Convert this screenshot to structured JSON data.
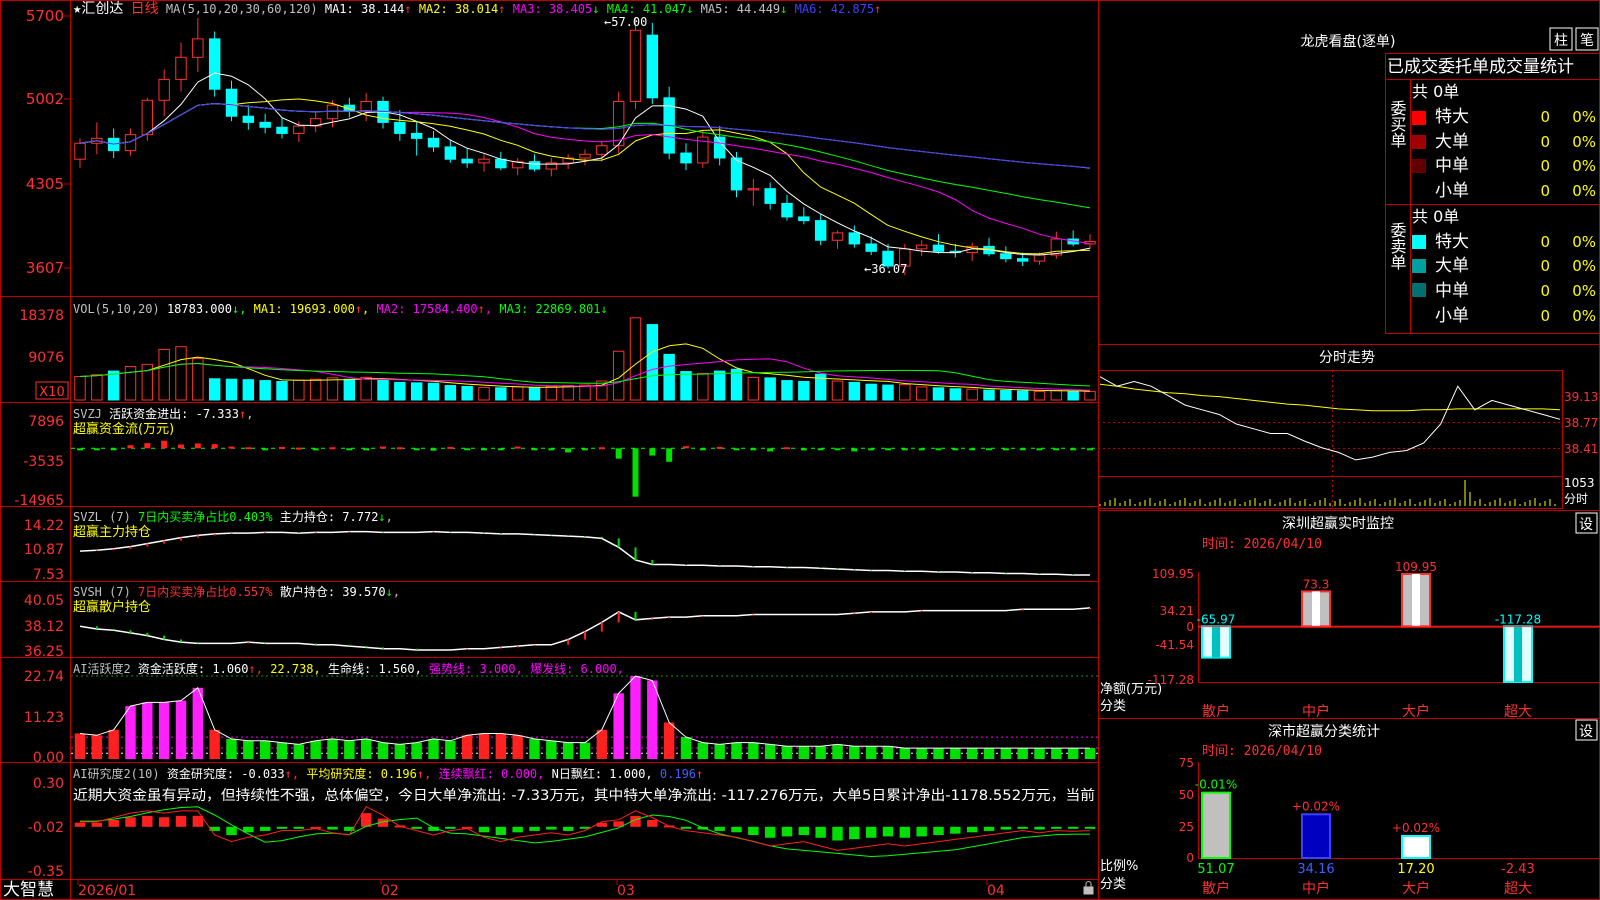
{
  "stock": {
    "name": "★汇创达",
    "period_label": "日线"
  },
  "price_panel": {
    "ma_label": "MA(5,10,20,30,60,120)",
    "mas": [
      {
        "label": "MA1: 38.144",
        "arrow": "↑",
        "color": "#ffffff"
      },
      {
        "label": "MA2: 38.014",
        "arrow": "↑",
        "color": "#ffff00"
      },
      {
        "label": "MA3: 38.405",
        "arrow": "↓",
        "color": "#ff00ff"
      },
      {
        "label": "MA4: 41.047",
        "arrow": "↓",
        "color": "#00ff00"
      },
      {
        "label": "MA5: 44.449",
        "arrow": "↓",
        "color": "#c0c0c0"
      },
      {
        "label": "MA6: 42.875",
        "arrow": "↑",
        "color": "#4040ff"
      }
    ],
    "yticks": [
      "5700",
      "5002",
      "4305",
      "3607"
    ],
    "high_label": "57.00",
    "low_label": "36.07"
  },
  "vol_panel": {
    "label": "VOL(5,10,20)",
    "value": "18783.000",
    "mas": [
      {
        "label": "MA1: 19693.000",
        "arrow": "↑",
        "color": "#ffff00"
      },
      {
        "label": "MA2: 17584.400",
        "arrow": "↑",
        "color": "#ff00ff"
      },
      {
        "label": "MA3: 22869.801",
        "arrow": "↓",
        "color": "#00ff00"
      }
    ],
    "yticks": [
      "18378",
      "9076"
    ],
    "unit": "X10"
  },
  "svzj_panel": {
    "label": "SVZJ",
    "desc": "活跃资金进出: -7.333",
    "arrow": "↑",
    "subtitle": "超赢资金流(万元)",
    "yticks": [
      "7896",
      "-3535",
      "-14965"
    ]
  },
  "svzl_panel": {
    "label": "SVZL (7)",
    "desc": "7日内买卖净占比0.403%",
    "hold": "主力持仓: 7.772",
    "arrow": "↓",
    "subtitle": "超赢主力持仓",
    "yticks": [
      "14.22",
      "10.87",
      "7.53"
    ]
  },
  "svsh_panel": {
    "label": "SVSH (7)",
    "desc": "7日内买卖净占比0.557%",
    "hold": "散户持仓: 39.570",
    "arrow": "↓",
    "subtitle": "超赢散户持仓",
    "yticks": [
      "40.05",
      "38.12",
      "36.25"
    ]
  },
  "ai_active_panel": {
    "label": "AI活跃度2",
    "desc": "资金活跃度: 1.060",
    "v2": "22.738,",
    "life": "生命线: 1.560,",
    "strong": "强势线: 3.000,",
    "burst": "爆发线: 6.000,",
    "yticks": [
      "22.74",
      "11.23",
      "0.00"
    ]
  },
  "ai_research_panel": {
    "label": "AI研究度2(10)",
    "desc": "资金研究度: -0.033",
    "avg": "平均研究度: 0.196",
    "consec": "连续飘红: 0.000,",
    "nday": "N日飘红: 1.000,",
    "last": "0.196",
    "comment": "近期大资金虽有异动，但持续性不强，总体偏空，今日大单净流出: -7.33万元，其中特大单净流出: -117.276万元，大单5日累计净出-1178.552万元，当前",
    "yticks": [
      "0.30",
      "-0.02",
      "-0.35"
    ]
  },
  "xaxis": {
    "labels": [
      "2026/01",
      "02",
      "03",
      "04"
    ]
  },
  "brand": "大智慧",
  "right": {
    "lhb": {
      "title": "龙虎看盘(逐单)",
      "btn1": "柱",
      "btn2": "笔",
      "tabs": "已成交委托单成交量统计"
    },
    "buy": {
      "side": "委买单",
      "total": "共 0单",
      "rows": [
        {
          "name": "特大",
          "count": "0",
          "pct": "0%",
          "color": "#ff0000"
        },
        {
          "name": "大单",
          "count": "0",
          "pct": "0%",
          "color": "#a00000"
        },
        {
          "name": "中单",
          "count": "0",
          "pct": "0%",
          "color": "#600000"
        },
        {
          "name": "小单",
          "count": "0",
          "pct": "0%",
          "color": ""
        }
      ]
    },
    "sell": {
      "side": "委卖单",
      "total": "共 0单",
      "rows": [
        {
          "name": "特大",
          "count": "0",
          "pct": "0%",
          "color": "#00ffff"
        },
        {
          "name": "大单",
          "count": "0",
          "pct": "0%",
          "color": "#00a0a0"
        },
        {
          "name": "中单",
          "count": "0",
          "pct": "0%",
          "color": "#007070"
        },
        {
          "name": "小单",
          "count": "0",
          "pct": "0%",
          "color": ""
        }
      ]
    },
    "intraday": {
      "title": "分时走势",
      "ticks": [
        "39.13",
        "38.77",
        "38.41"
      ],
      "vol_tick": "1053",
      "vol_label": "分时"
    },
    "monitor": {
      "title": "深圳超赢实时监控",
      "btn": "设",
      "time": "时间: 2026/04/10",
      "yticks": [
        "109.95",
        "34.21",
        "0",
        "-41.54",
        "-117.28"
      ],
      "ylabel": "净额(万元)",
      "xlabel": "分类"
    },
    "classify": {
      "title": "深市超赢分类统计",
      "btn": "设",
      "time": "时间: 2026/04/10",
      "yticks": [
        "75",
        "50",
        "25",
        "0"
      ],
      "ylabel": "比例%",
      "xlabel": "分类"
    }
  },
  "chart_data": [
    {
      "type": "candlestick",
      "title": "★汇创达 日线",
      "x_range": [
        "2026/01",
        "2026/04/10"
      ],
      "ylim": [
        36.07,
        57.0
      ],
      "ohlc": [
        [
          45.5,
          47.2,
          44.8,
          46.8
        ],
        [
          46.8,
          48.5,
          45.9,
          47.2
        ],
        [
          47.2,
          48.0,
          45.6,
          46.2
        ],
        [
          46.2,
          48.0,
          45.8,
          47.5
        ],
        [
          47.5,
          50.5,
          47.0,
          50.3
        ],
        [
          50.3,
          52.8,
          49.0,
          52.0
        ],
        [
          52.0,
          55.0,
          51.0,
          53.8
        ],
        [
          53.8,
          57.0,
          52.6,
          55.3
        ],
        [
          55.3,
          55.9,
          50.6,
          51.2
        ],
        [
          51.2,
          51.9,
          48.6,
          49.0
        ],
        [
          49.0,
          49.9,
          47.9,
          48.5
        ],
        [
          48.5,
          49.2,
          47.6,
          48.1
        ],
        [
          48.1,
          48.9,
          47.2,
          47.6
        ],
        [
          47.6,
          48.6,
          46.9,
          48.2
        ],
        [
          48.2,
          49.3,
          47.7,
          48.8
        ],
        [
          48.8,
          50.3,
          48.1,
          49.9
        ],
        [
          49.9,
          50.5,
          48.9,
          49.4
        ],
        [
          49.4,
          50.9,
          48.6,
          50.2
        ],
        [
          50.2,
          50.6,
          48.0,
          48.5
        ],
        [
          48.5,
          49.5,
          47.0,
          47.6
        ],
        [
          47.6,
          48.6,
          45.8,
          47.2
        ],
        [
          47.2,
          47.8,
          46.1,
          46.5
        ],
        [
          46.5,
          47.1,
          45.2,
          45.5
        ],
        [
          45.5,
          46.4,
          44.8,
          45.2
        ],
        [
          45.2,
          45.9,
          44.5,
          45.5
        ],
        [
          45.5,
          46.1,
          44.6,
          44.8
        ],
        [
          44.8,
          45.6,
          44.2,
          45.3
        ],
        [
          45.3,
          45.9,
          44.5,
          44.7
        ],
        [
          44.7,
          45.6,
          44.1,
          45.2
        ],
        [
          45.2,
          45.9,
          44.7,
          45.6
        ],
        [
          45.6,
          46.3,
          45.0,
          45.9
        ],
        [
          45.9,
          47.0,
          45.3,
          46.6
        ],
        [
          46.6,
          51.0,
          46.0,
          50.2
        ],
        [
          50.2,
          57.0,
          49.6,
          56.0
        ],
        [
          55.6,
          56.6,
          50.0,
          50.5
        ],
        [
          50.5,
          51.4,
          45.5,
          46.0
        ],
        [
          46.0,
          46.8,
          44.6,
          45.2
        ],
        [
          45.2,
          47.9,
          44.8,
          47.3
        ],
        [
          47.3,
          48.2,
          45.0,
          45.6
        ],
        [
          45.6,
          46.1,
          42.4,
          43.0
        ],
        [
          43.0,
          43.9,
          41.7,
          43.1
        ],
        [
          43.1,
          43.6,
          41.4,
          41.9
        ],
        [
          41.9,
          42.6,
          40.5,
          40.8
        ],
        [
          40.8,
          41.6,
          40.2,
          40.5
        ],
        [
          40.5,
          41.0,
          38.5,
          38.9
        ],
        [
          38.9,
          39.7,
          38.2,
          39.5
        ],
        [
          39.5,
          40.1,
          38.3,
          38.6
        ],
        [
          38.6,
          39.2,
          37.7,
          38.0
        ],
        [
          38.0,
          38.6,
          36.6,
          36.8
        ],
        [
          36.8,
          38.6,
          36.07,
          38.2
        ],
        [
          38.2,
          38.9,
          37.6,
          38.5
        ],
        [
          38.5,
          39.4,
          37.8,
          38.0
        ],
        [
          38.0,
          38.6,
          37.5,
          37.9
        ],
        [
          37.9,
          38.7,
          37.2,
          38.4
        ],
        [
          38.4,
          39.1,
          37.6,
          37.8
        ],
        [
          37.8,
          38.4,
          37.1,
          37.4
        ],
        [
          37.4,
          37.9,
          36.8,
          37.2
        ],
        [
          37.2,
          37.9,
          36.9,
          37.7
        ],
        [
          37.7,
          39.6,
          37.4,
          39.0
        ],
        [
          39.0,
          39.7,
          38.4,
          38.6
        ],
        [
          38.6,
          39.4,
          38.2,
          38.8
        ]
      ],
      "ma_series": [
        {
          "name": "MA1",
          "last": 38.144
        },
        {
          "name": "MA2",
          "last": 38.014
        },
        {
          "name": "MA3",
          "last": 38.405
        },
        {
          "name": "MA4",
          "last": 41.047
        },
        {
          "name": "MA5",
          "last": 44.449
        },
        {
          "name": "MA6",
          "last": 42.875
        }
      ]
    },
    {
      "type": "bar",
      "title": "VOL(5,10,20)",
      "unit": "X10",
      "ylim": [
        0,
        18378
      ],
      "values": [
        5200,
        5600,
        6400,
        7400,
        7900,
        11200,
        11800,
        9200,
        4700,
        4600,
        4500,
        4300,
        4100,
        4400,
        4600,
        4900,
        4600,
        5000,
        4400,
        3900,
        3800,
        3700,
        3200,
        3000,
        2800,
        2700,
        2900,
        2700,
        3000,
        3200,
        3300,
        4200,
        10800,
        18200,
        16700,
        10100,
        6300,
        5900,
        6400,
        6800,
        5000,
        4900,
        4300,
        4100,
        5700,
        4200,
        3900,
        3500,
        3300,
        3400,
        2900,
        2700,
        2500,
        2400,
        2200,
        2100,
        2000,
        1900,
        2100,
        2000,
        1900
      ],
      "ma_last": {
        "MA1": 19693.0,
        "MA2": 17584.4,
        "MA3": 22869.801
      }
    },
    {
      "type": "bar",
      "title": "超赢资金流(万元)",
      "ylim": [
        -14965,
        7896
      ],
      "values": [
        -600,
        -500,
        -400,
        900,
        1500,
        2200,
        1100,
        1400,
        1200,
        500,
        300,
        -400,
        400,
        200,
        -600,
        300,
        -400,
        -300,
        500,
        300,
        -500,
        -700,
        400,
        -300,
        -400,
        -500,
        500,
        -300,
        -200,
        -1200,
        -600,
        300,
        -3000,
        -14000,
        -2100,
        -3900,
        600,
        -300,
        400,
        -500,
        -300,
        -900,
        300,
        -600,
        -400,
        -300,
        -900,
        -400,
        -300,
        -300,
        -200,
        -300,
        -400,
        -300,
        -300,
        -300,
        -400,
        -200,
        -300,
        -300,
        -400
      ]
    },
    {
      "type": "line",
      "title": "超赢主力持仓",
      "ylim": [
        7.53,
        14.22
      ],
      "values": [
        11.0,
        11.1,
        11.3,
        11.6,
        12.0,
        12.4,
        12.8,
        13.1,
        13.3,
        13.4,
        13.4,
        13.5,
        13.5,
        13.4,
        13.5,
        13.5,
        13.6,
        13.6,
        13.5,
        13.5,
        13.5,
        13.6,
        13.5,
        13.5,
        13.4,
        13.3,
        13.3,
        13.2,
        13.1,
        13.0,
        12.9,
        12.7,
        11.5,
        9.8,
        9.2,
        9.2,
        9.1,
        9.1,
        9.0,
        9.0,
        8.9,
        8.9,
        8.8,
        8.8,
        8.7,
        8.6,
        8.5,
        8.4,
        8.4,
        8.3,
        8.3,
        8.2,
        8.2,
        8.1,
        8.1,
        8.0,
        8.0,
        7.9,
        7.9,
        7.8,
        7.8
      ]
    },
    {
      "type": "line",
      "title": "超赢散户持仓",
      "ylim": [
        36.25,
        40.05
      ],
      "values": [
        38.2,
        38.0,
        37.9,
        37.7,
        37.5,
        37.2,
        37.0,
        36.9,
        36.9,
        36.9,
        37.0,
        36.9,
        36.9,
        36.9,
        36.8,
        36.8,
        36.7,
        36.6,
        36.5,
        36.5,
        36.4,
        36.4,
        36.4,
        36.5,
        36.5,
        36.6,
        36.7,
        36.8,
        36.8,
        37.2,
        37.8,
        38.5,
        39.3,
        38.7,
        38.8,
        38.9,
        38.9,
        39.0,
        39.0,
        39.0,
        39.1,
        39.1,
        39.1,
        39.1,
        39.1,
        39.1,
        39.2,
        39.3,
        39.3,
        39.3,
        39.4,
        39.4,
        39.4,
        39.4,
        39.4,
        39.4,
        39.5,
        39.5,
        39.5,
        39.5,
        39.6
      ]
    },
    {
      "type": "bar",
      "title": "AI活跃度2",
      "ylim": [
        0,
        22.74
      ],
      "values": [
        7.0,
        6.5,
        8.0,
        14.5,
        15.5,
        15.5,
        16.0,
        19.5,
        8.0,
        5.5,
        5.0,
        5.0,
        4.5,
        4.0,
        5.0,
        5.5,
        5.0,
        5.5,
        4.5,
        4.0,
        4.5,
        5.5,
        5.0,
        6.5,
        7.0,
        7.0,
        6.5,
        5.5,
        5.0,
        4.5,
        4.5,
        8.0,
        18.0,
        22.7,
        21.5,
        10.0,
        6.0,
        4.5,
        4.0,
        4.5,
        4.5,
        4.0,
        3.5,
        3.5,
        3.5,
        4.0,
        3.5,
        3.5,
        3.5,
        3.0,
        3.0,
        3.0,
        3.0,
        3.0,
        3.0,
        3.0,
        3.0,
        3.0,
        3.0,
        3.0,
        3.0
      ],
      "lines": {
        "生命线": 1.56,
        "强势线": 3.0,
        "爆发线": 6.0
      }
    },
    {
      "type": "bar",
      "title": "AI研究度2(10)",
      "ylim": [
        -0.35,
        0.3
      ],
      "values": [
        0.01,
        0.01,
        0.03,
        0.05,
        0.06,
        0.05,
        0.06,
        0.06,
        -0.05,
        -0.08,
        -0.06,
        -0.05,
        -0.03,
        -0.03,
        -0.02,
        -0.04,
        -0.05,
        0.08,
        0.04,
        -0.01,
        -0.03,
        -0.05,
        -0.03,
        -0.02,
        -0.06,
        -0.08,
        -0.06,
        -0.05,
        -0.04,
        -0.05,
        -0.03,
        0.01,
        0.02,
        0.06,
        0.03,
        -0.01,
        -0.03,
        -0.04,
        -0.05,
        -0.06,
        -0.08,
        -0.1,
        -0.09,
        -0.08,
        -0.1,
        -0.12,
        -0.11,
        -0.1,
        -0.09,
        -0.1,
        -0.09,
        -0.08,
        -0.07,
        -0.06,
        -0.05,
        -0.04,
        -0.03,
        -0.04,
        -0.03,
        -0.033,
        -0.03
      ]
    },
    {
      "type": "bar",
      "title": "深圳超赢实时监控",
      "categories": [
        "散户",
        "中户",
        "大户",
        "超大"
      ],
      "values": [
        -65.97,
        73.3,
        109.95,
        -117.28
      ],
      "ylim": [
        -117.28,
        109.95
      ]
    },
    {
      "type": "bar",
      "title": "深市超赢分类统计",
      "categories": [
        "散户",
        "中户",
        "大户",
        "超大"
      ],
      "values": [
        51.07,
        34.16,
        17.2,
        -2.43
      ],
      "changes": [
        "-0.01%",
        "+0.02%",
        "+0.02%",
        ""
      ],
      "ylim": [
        0,
        75
      ]
    },
    {
      "type": "line",
      "title": "分时走势",
      "ticks": [
        39.13,
        38.77,
        38.41
      ]
    }
  ]
}
